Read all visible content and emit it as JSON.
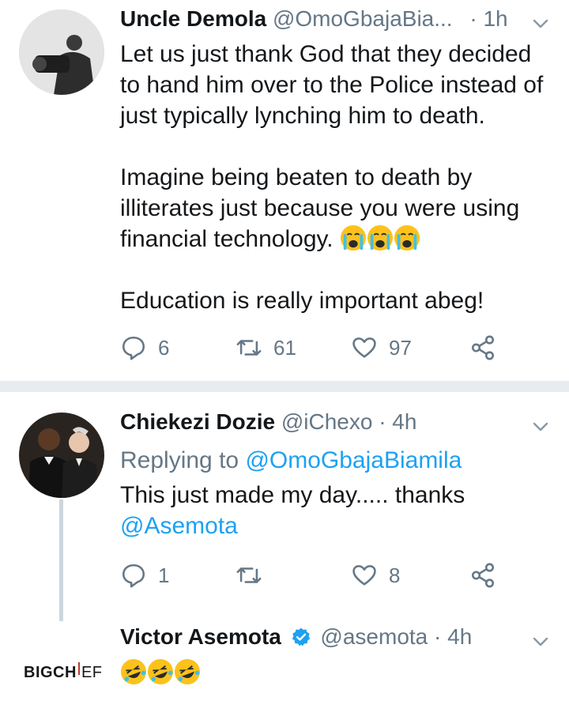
{
  "tweets": [
    {
      "name": "Uncle Demola",
      "handle": "@OmoGbajaBia...",
      "time": "· 1h",
      "paragraphs": [
        "Let us just thank God that they decided to hand him over to the Police instead of just typically lynching him to death.",
        "Imagine being beaten to death by illiterates just because you were using financial technology.",
        "Education is really important abeg!"
      ],
      "replies": "6",
      "retweets": "61",
      "likes": "97"
    },
    {
      "name": "Chiekezi Dozie",
      "handle": "@iChexo · 4h",
      "replying_prefix": "Replying to ",
      "replying_to": "@OmoGbajaBiamila",
      "text": "This just made my day..... thanks ",
      "mention": "@Asemota",
      "replies": "1",
      "retweets": "",
      "likes": "8"
    },
    {
      "name": "Victor Asemota",
      "handle": "@asemota · 4h",
      "verified": true
    }
  ],
  "watermark": {
    "bold": "BIGCH",
    "rest": "EF"
  },
  "colors": {
    "link": "#1da1f2",
    "muted": "#657786",
    "divider": "#e6ecf0",
    "emoji": "#fcc21b"
  },
  "icons": [
    "reply-icon",
    "retweet-icon",
    "like-icon",
    "share-icon",
    "chevron-down-icon",
    "verified-badge-icon",
    "crying-emoji",
    "laughing-emoji"
  ]
}
